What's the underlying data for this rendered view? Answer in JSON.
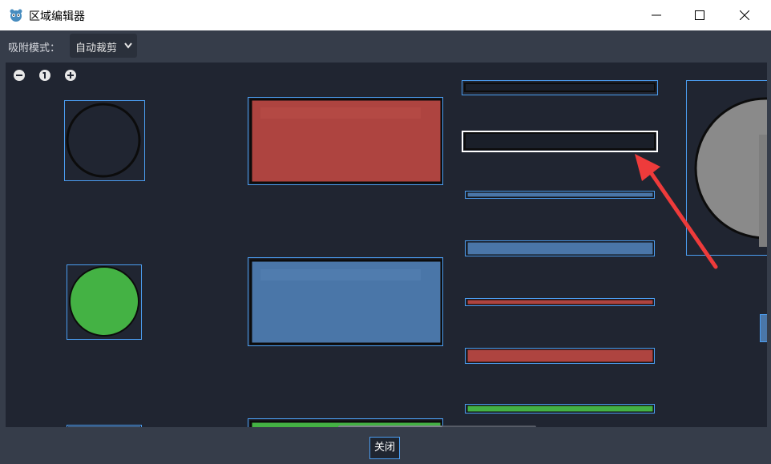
{
  "window": {
    "title": "区域编辑器",
    "app_icon": "godot-icon",
    "controls": [
      "minimize-icon",
      "maximize-icon",
      "close-icon"
    ]
  },
  "toolbar": {
    "snap_label": "吸附模式：",
    "snap_mode": {
      "selected": "自动裁剪",
      "icon": "chevron-down-icon"
    }
  },
  "canvas": {
    "zoom_controls": [
      "zoom-out-icon",
      "zoom-reset-icon",
      "zoom-in-icon"
    ],
    "colors": {
      "background": "#202531",
      "selection": "#4b9df0",
      "active_selection": "#ffffff",
      "red": "#ae4440",
      "blue": "#4a76a8",
      "green": "#44b244",
      "gray": "#8a8a8a",
      "arrow": "#ee3b3b"
    }
  },
  "footer": {
    "close_label": "关闭"
  }
}
